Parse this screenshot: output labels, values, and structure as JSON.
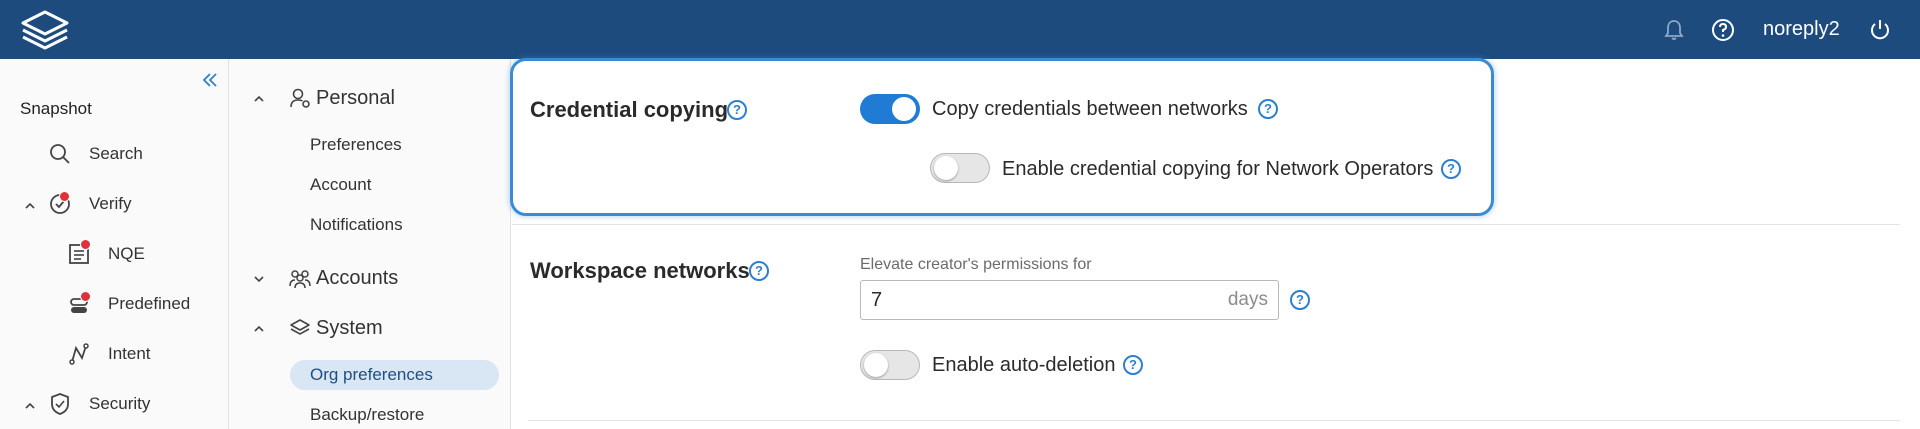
{
  "topbar": {
    "logo_icon": "app-logo-icon",
    "username": "noreply2",
    "icons": [
      "bell-icon",
      "help-icon",
      "power-icon"
    ],
    "color": "#1d4b7e"
  },
  "leftnav": {
    "section": "Snapshot",
    "items": [
      {
        "label": "Search",
        "icon": "search-icon"
      },
      {
        "label": "Verify",
        "icon": "verify-icon"
      },
      {
        "label": "NQE",
        "icon": "nqe-icon"
      },
      {
        "label": "Predefined",
        "icon": "predefined-icon"
      },
      {
        "label": "Intent",
        "icon": "intent-icon"
      },
      {
        "label": "Security",
        "icon": "shield-icon"
      }
    ]
  },
  "subnav": {
    "groups": [
      {
        "label": "Personal",
        "icon": "user-gear-icon"
      },
      {
        "label": "Accounts",
        "icon": "users-icon"
      },
      {
        "label": "System",
        "icon": "layers-icon"
      }
    ],
    "personal_items": [
      "Preferences",
      "Account",
      "Notifications"
    ],
    "system_items": [
      "Org preferences",
      "Backup/restore"
    ]
  },
  "content": {
    "credential": {
      "title": "Credential copying",
      "copy_label": "Copy credentials between networks",
      "copy_on": true,
      "operators_label": "Enable credential copying for Network Operators",
      "operators_on": false
    },
    "workspace": {
      "title": "Workspace networks",
      "elevate_label": "Elevate creator's permissions for",
      "elevate_value": "7",
      "elevate_suffix": "days",
      "autodel_label": "Enable auto-deletion",
      "autodel_on": false
    },
    "help_glyph": "?",
    "accent": "#1f7bd4"
  }
}
